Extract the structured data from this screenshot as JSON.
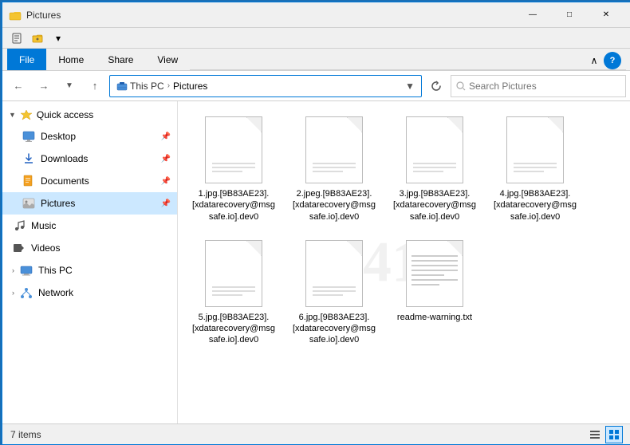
{
  "window": {
    "title": "Pictures",
    "controls": {
      "minimize": "—",
      "maximize": "□",
      "close": "✕"
    }
  },
  "quick_toolbar": {
    "items": [
      "properties",
      "new-folder",
      "dropdown"
    ]
  },
  "ribbon": {
    "tabs": [
      "File",
      "Home",
      "Share",
      "View"
    ],
    "active_tab": "File"
  },
  "address_bar": {
    "back_disabled": false,
    "forward_disabled": false,
    "up_disabled": false,
    "path": [
      "This PC",
      "Pictures"
    ],
    "search_placeholder": "Search Pictures"
  },
  "sidebar": {
    "sections": [
      {
        "id": "quick-access",
        "label": "Quick access",
        "expanded": true,
        "items": [
          {
            "id": "desktop",
            "label": "Desktop",
            "pinned": true
          },
          {
            "id": "downloads",
            "label": "Downloads",
            "pinned": true
          },
          {
            "id": "documents",
            "label": "Documents",
            "pinned": true
          },
          {
            "id": "pictures",
            "label": "Pictures",
            "pinned": true,
            "active": true
          }
        ]
      },
      {
        "id": "music",
        "label": "Music",
        "items": []
      },
      {
        "id": "videos",
        "label": "Videos",
        "items": []
      },
      {
        "id": "this-pc",
        "label": "This PC",
        "items": []
      },
      {
        "id": "network",
        "label": "Network",
        "items": []
      }
    ]
  },
  "files": [
    {
      "id": "file1",
      "name": "1.jpg.[9B83AE23].[xdatarecovery@msgsafe.io].dev0",
      "type": "doc"
    },
    {
      "id": "file2",
      "name": "2.jpeg.[9B83AE23].[xdatarecovery@msgsafe.io].dev0",
      "type": "doc"
    },
    {
      "id": "file3",
      "name": "3.jpg.[9B83AE23].[xdatarecovery@msgsafe.io].dev0",
      "type": "doc"
    },
    {
      "id": "file4",
      "name": "4.jpg.[9B83AE23].[xdatarecovery@msgsafe.io].dev0",
      "type": "doc"
    },
    {
      "id": "file5",
      "name": "5.jpg.[9B83AE23].[xdatarecovery@msgsafe.io].dev0",
      "type": "doc"
    },
    {
      "id": "file6",
      "name": "6.jpg.[9B83AE23].[xdatarecovery@msgsafe.io].dev0",
      "type": "doc"
    },
    {
      "id": "file7",
      "name": "readme-warning.txt",
      "type": "txt"
    }
  ],
  "status_bar": {
    "count": "7",
    "items_label": "items"
  },
  "watermark_text": "411"
}
